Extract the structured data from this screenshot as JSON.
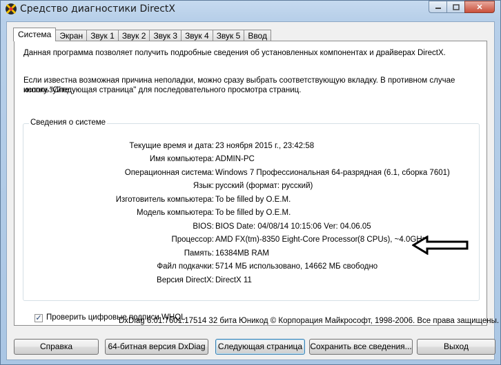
{
  "window": {
    "title": "Средство диагностики DirectX",
    "controls": {
      "close": "✕"
    }
  },
  "tabs": [
    {
      "label": "Система",
      "active": true
    },
    {
      "label": "Экран"
    },
    {
      "label": "Звук 1"
    },
    {
      "label": "Звук 2"
    },
    {
      "label": "Звук 3"
    },
    {
      "label": "Звук 4"
    },
    {
      "label": "Звук 5"
    },
    {
      "label": "Ввод"
    }
  ],
  "intro": {
    "line1": "Данная программа позволяет получить подробные сведения об установленных компонентах и драйверах DirectX.",
    "line2": "Если известна возможная причина неполадки, можно сразу выбрать соответствующую вкладку. В противном случае используйте",
    "line3": "кнопку \"Следующая страница\" для последовательного просмотра страниц."
  },
  "system_info": {
    "title": "Сведения о системе",
    "rows": [
      {
        "label": "Текущие время и дата:",
        "value": "23 ноября 2015 г., 23:42:58"
      },
      {
        "label": "Имя компьютера:",
        "value": "ADMIN-PC"
      },
      {
        "label": "Операционная система:",
        "value": "Windows 7 Профессиональная 64-разрядная (6.1, сборка 7601)"
      },
      {
        "label": "Язык:",
        "value": "русский (формат: русский)"
      },
      {
        "label": "Изготовитель компьютера:",
        "value": "To be filled by O.E.M."
      },
      {
        "label": "Модель компьютера:",
        "value": "To be filled by O.E.M."
      },
      {
        "label": "BIOS:",
        "value": "BIOS Date: 04/08/14 10:15:06 Ver: 04.06.05"
      },
      {
        "label": "Процессор:",
        "value": "AMD FX(tm)-8350 Eight-Core Processor",
        "value_extra": "(8 CPUs), ~4.0GHz"
      },
      {
        "label": "Память:",
        "value": "16384MB RAM"
      },
      {
        "label": "Файл подкачки:",
        "value": "5714 МБ использовано, 14662 МБ свободно"
      },
      {
        "label": "Версия DirectX:",
        "value": "DirectX 11"
      }
    ]
  },
  "whql": {
    "label": "Проверить цифровые подписи WHQL",
    "checked": true,
    "mark": "✓"
  },
  "footer": "DxDiag 6.01.7601.17514 32 бита Юникод  © Корпорация Майкрософт, 1998-2006.  Все права защищены.",
  "buttons": {
    "help": "Справка",
    "dxdiag64": "64-битная версия DxDiag",
    "next_page": "Следующая страница",
    "save_all": "Сохранить все сведения...",
    "exit": "Выход"
  },
  "colors": {
    "title_bar": "#b7cfe9",
    "close_button": "#c9503b",
    "default_button_border": "#3c7fb1"
  }
}
